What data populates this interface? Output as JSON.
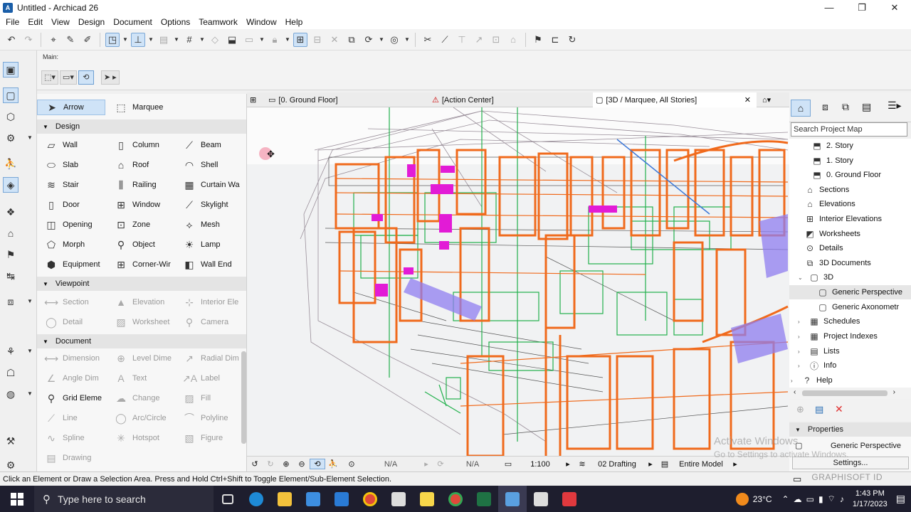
{
  "window": {
    "title": "Untitled - Archicad 26",
    "minimize": "—",
    "restore": "❐",
    "close": "✕"
  },
  "menu": [
    "File",
    "Edit",
    "View",
    "Design",
    "Document",
    "Options",
    "Teamwork",
    "Window",
    "Help"
  ],
  "infobox": {
    "label": "Main:"
  },
  "toolbox": {
    "arrow": "Arrow",
    "marquee": "Marquee",
    "design_header": "Design",
    "design": [
      "Wall",
      "Column",
      "Beam",
      "Slab",
      "Roof",
      "Shell",
      "Stair",
      "Railing",
      "Curtain Wa",
      "Door",
      "Window",
      "Skylight",
      "Opening",
      "Zone",
      "Mesh",
      "Morph",
      "Object",
      "Lamp",
      "Equipment",
      "Corner-Wir",
      "Wall End"
    ],
    "viewpoint_header": "Viewpoint",
    "viewpoint": [
      "Section",
      "Elevation",
      "Interior Ele",
      "Detail",
      "Worksheet",
      "Camera"
    ],
    "document_header": "Document",
    "document": [
      "Dimension",
      "Level Dime",
      "Radial Dim",
      "Angle Dim",
      "Text",
      "Label",
      "Grid Eleme",
      "Change",
      "Fill",
      "Line",
      "Arc/Circle",
      "Polyline",
      "Spline",
      "Hotspot",
      "Figure",
      "Drawing"
    ]
  },
  "tabs": [
    {
      "label": "[0. Ground Floor]"
    },
    {
      "label": "[Action Center]"
    },
    {
      "label": "[3D / Marquee, All Stories]",
      "close": "✕"
    }
  ],
  "viewbar": {
    "na1": "N/A",
    "na2": "N/A",
    "scale": "1:100",
    "layer": "02 Drafting",
    "model": "Entire Model"
  },
  "navigator": {
    "search_placeholder": "Search Project Map",
    "items": [
      {
        "label": "2. Story",
        "level": 2
      },
      {
        "label": "1. Story",
        "level": 2
      },
      {
        "label": "0. Ground Floor",
        "level": 2
      },
      {
        "label": "Sections",
        "level": 1
      },
      {
        "label": "Elevations",
        "level": 1
      },
      {
        "label": "Interior Elevations",
        "level": 1
      },
      {
        "label": "Worksheets",
        "level": 1
      },
      {
        "label": "Details",
        "level": 1
      },
      {
        "label": "3D Documents",
        "level": 1
      },
      {
        "label": "3D",
        "level": 1,
        "expanded": true
      },
      {
        "label": "Generic Perspective",
        "level": 2,
        "selected": true
      },
      {
        "label": "Generic Axonometr",
        "level": 2
      },
      {
        "label": "Schedules",
        "level": 1,
        "collapsed": true
      },
      {
        "label": "Project Indexes",
        "level": 1,
        "collapsed": true
      },
      {
        "label": "Lists",
        "level": 1,
        "collapsed": true
      },
      {
        "label": "Info",
        "level": 1,
        "collapsed": true
      },
      {
        "label": "Help",
        "level": 0,
        "collapsed": true
      }
    ],
    "properties_header": "Properties",
    "properties_value": "Generic Perspective",
    "settings": "Settings..."
  },
  "status": {
    "text": "Click an Element or Draw a Selection Area. Press and Hold Ctrl+Shift to Toggle Element/Sub-Element Selection.",
    "brand": "GRAPHISOFT ID"
  },
  "watermark": {
    "line1": "Activate Windows",
    "line2": "Go to Settings to activate Windows."
  },
  "taskbar": {
    "search_placeholder": "Type here to search",
    "temperature": "23°C",
    "time": "1:43 PM",
    "date": "1/17/2023"
  },
  "colors": {
    "accent": "#cfe3f7",
    "orange": "#f06a1c",
    "green": "#22b14c",
    "magenta": "#e21bd6",
    "taskbar": "#1e1e2e"
  }
}
